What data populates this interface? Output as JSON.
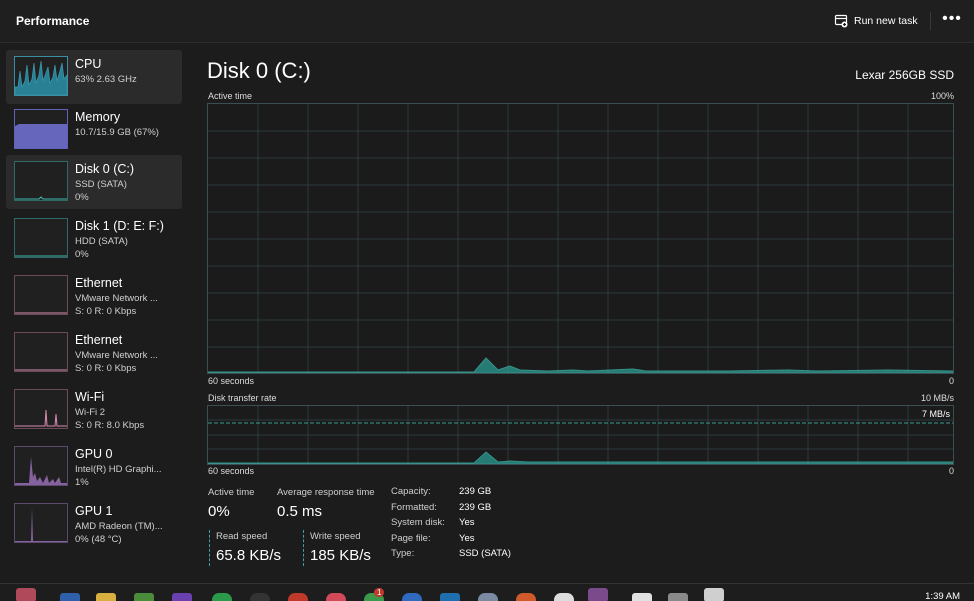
{
  "header": {
    "title": "Performance",
    "run_task_label": "Run new task",
    "more_label": "•••"
  },
  "sidebar": {
    "items": [
      {
        "name": "CPU",
        "sub1": "63%  2.63 GHz",
        "sub2": ""
      },
      {
        "name": "Memory",
        "sub1": "10.7/15.9 GB (67%)",
        "sub2": ""
      },
      {
        "name": "Disk 0 (C:)",
        "sub1": "SSD (SATA)",
        "sub2": "0%"
      },
      {
        "name": "Disk 1 (D: E: F:)",
        "sub1": "HDD (SATA)",
        "sub2": "0%"
      },
      {
        "name": "Ethernet",
        "sub1": "VMware Network ...",
        "sub2": "S: 0  R: 0 Kbps"
      },
      {
        "name": "Ethernet",
        "sub1": "VMware Network ...",
        "sub2": "S: 0  R: 0 Kbps"
      },
      {
        "name": "Wi-Fi",
        "sub1": "Wi-Fi 2",
        "sub2": "S: 0  R: 8.0 Kbps"
      },
      {
        "name": "GPU 0",
        "sub1": "Intel(R) HD Graphi...",
        "sub2": "1%"
      },
      {
        "name": "GPU 1",
        "sub1": "AMD Radeon (TM)...",
        "sub2": "0% (48 °C)"
      }
    ]
  },
  "main": {
    "title": "Disk 0 (C:)",
    "model": "Lexar 256GB SSD",
    "active_time_graph": {
      "label": "Active time",
      "max_label": "100%",
      "x_left_label": "60 seconds",
      "x_right_label": "0"
    },
    "transfer_graph": {
      "label": "Disk transfer rate",
      "max_label": "10 MB/s",
      "line_label": "7 MB/s",
      "x_left_label": "60 seconds",
      "x_right_label": "0"
    },
    "stats": {
      "active_time_label": "Active time",
      "active_time_value": "0%",
      "avg_response_label": "Average response time",
      "avg_response_value": "0.5 ms",
      "read_speed_label": "Read speed",
      "read_speed_value": "65.8 KB/s",
      "write_speed_label": "Write speed",
      "write_speed_value": "185 KB/s"
    },
    "properties": [
      {
        "label": "Capacity:",
        "value": "239 GB"
      },
      {
        "label": "Formatted:",
        "value": "239 GB"
      },
      {
        "label": "System disk:",
        "value": "Yes"
      },
      {
        "label": "Page file:",
        "value": "Yes"
      },
      {
        "label": "Type:",
        "value": "SSD (SATA)"
      }
    ]
  },
  "taskbar": {
    "time": "1:39 AM",
    "notification_badge": "1"
  },
  "colors": {
    "accent_disk": "#3fb9ae",
    "accent_cpu": "#2ea8c6",
    "accent_memory": "#7d7ff0",
    "accent_network": "#d98bb0",
    "accent_gpu": "#b07fd6"
  }
}
